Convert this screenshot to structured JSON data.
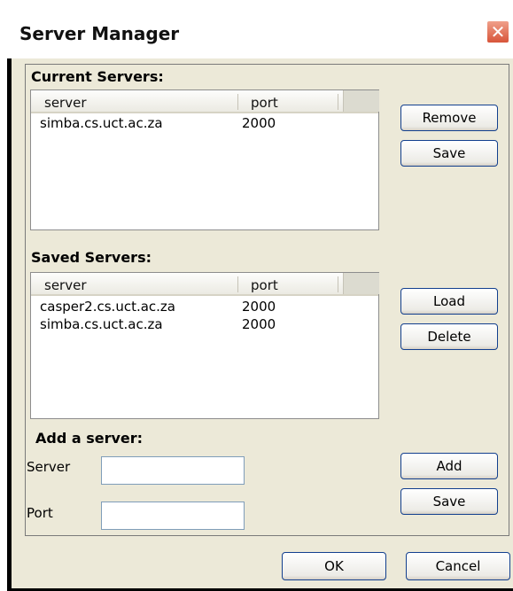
{
  "window": {
    "title": "Server Manager"
  },
  "current_servers": {
    "title": "Current Servers:",
    "columns": [
      "server",
      "port"
    ],
    "rows": [
      {
        "server": "simba.cs.uct.ac.za",
        "port": "2000"
      }
    ],
    "buttons": {
      "remove": "Remove",
      "save": "Save"
    }
  },
  "saved_servers": {
    "title": "Saved Servers:",
    "columns": [
      "server",
      "port"
    ],
    "rows": [
      {
        "server": "casper2.cs.uct.ac.za",
        "port": "2000"
      },
      {
        "server": "simba.cs.uct.ac.za",
        "port": "2000"
      }
    ],
    "buttons": {
      "load": "Load",
      "delete": "Delete"
    }
  },
  "add_server": {
    "title": "Add a server:",
    "server_label": "Server",
    "port_label": "Port",
    "server_value": "",
    "port_value": "",
    "buttons": {
      "add": "Add",
      "save": "Save"
    }
  },
  "footer": {
    "ok": "OK",
    "cancel": "Cancel"
  },
  "icons": {
    "close": "close-icon"
  },
  "colors": {
    "dialog_bg": "#ece9d8",
    "button_border": "#123f8e",
    "close_button": "#d8553a"
  }
}
